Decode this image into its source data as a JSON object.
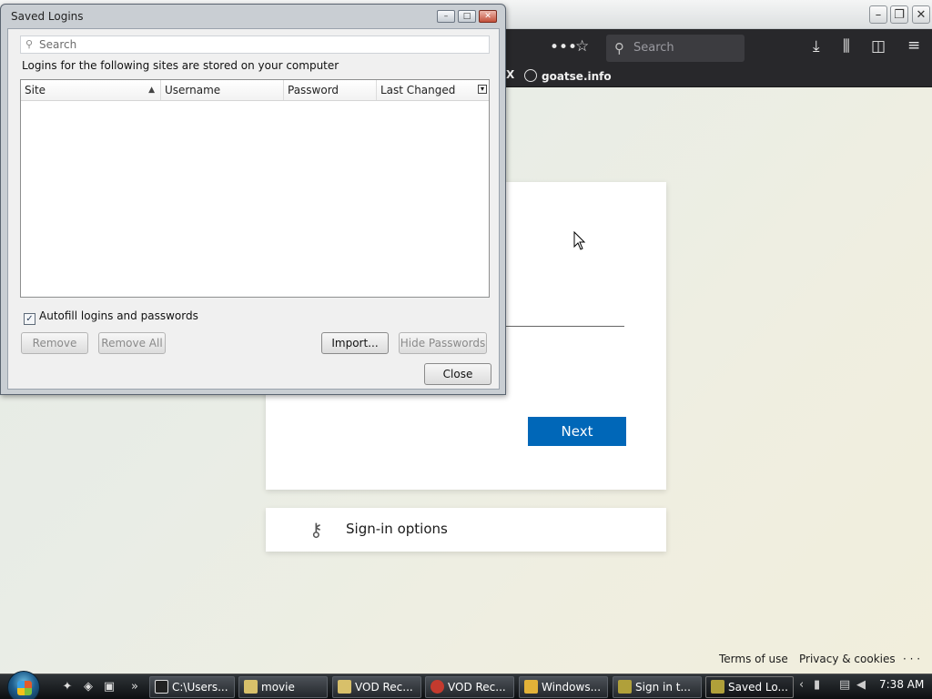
{
  "browser": {
    "search_placeholder": "Search",
    "bookmark_label": "goatse.info",
    "bookmark_partial": "X"
  },
  "signin": {
    "next_label": "Next",
    "options_label": "Sign-in options",
    "footer": {
      "terms": "Terms of use",
      "privacy": "Privacy & cookies",
      "more": "· · ·"
    }
  },
  "dialog": {
    "title": "Saved Logins",
    "search_placeholder": "Search",
    "description": "Logins for the following sites are stored on your computer",
    "columns": [
      "Site",
      "Username",
      "Password",
      "Last Changed"
    ],
    "autofill_label": "Autofill logins and passwords",
    "autofill_checked": true,
    "buttons": {
      "remove": "Remove",
      "remove_all": "Remove All",
      "import": "Import...",
      "hide_passwords": "Hide Passwords",
      "close": "Close"
    }
  },
  "taskbar": {
    "tasks": [
      {
        "label": "C:\\Users..."
      },
      {
        "label": "movie"
      },
      {
        "label": "VOD Rec..."
      },
      {
        "label": "VOD Rec..."
      },
      {
        "label": "Windows..."
      },
      {
        "label": "Sign in t..."
      },
      {
        "label": "Saved Lo..."
      }
    ],
    "clock": "7:38 AM"
  },
  "colors": {
    "accent": "#0067b8",
    "toolbar": "#28282b"
  }
}
